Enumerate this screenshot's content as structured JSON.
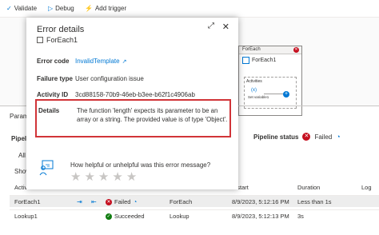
{
  "toolbar": {
    "validate": "Validate",
    "debug": "Debug",
    "add_trigger": "Add trigger"
  },
  "canvas": {
    "card_header": "ForEach",
    "card_title": "ForEach1",
    "activities_label": "Activities",
    "inner_activity": "Set variable1",
    "inner_symbol": "(x)"
  },
  "bottom": {
    "param_tab": "Param",
    "pipeline_run_label": "Pipeli",
    "all_label": "All",
    "show_label": "Show",
    "pipeline_status_label": "Pipeline status",
    "pipeline_status_value": "Failed",
    "columns": {
      "activity": "Activi",
      "run_start": "n start",
      "duration": "Duration",
      "log": "Log"
    },
    "rows": [
      {
        "name": "ForEach1",
        "status": "Failed",
        "type": "ForEach",
        "run_start": "8/9/2023, 5:12:16 PM",
        "duration": "Less than 1s",
        "status_color": "#c50f1f"
      },
      {
        "name": "Lookup1",
        "status": "Succeeded",
        "type": "Lookup",
        "run_start": "8/9/2023, 5:12:13 PM",
        "duration": "3s",
        "status_color": "#107c10"
      }
    ]
  },
  "modal": {
    "title": "Error details",
    "subtitle": "ForEach1",
    "error_code_label": "Error code",
    "error_code_value": "InvalidTemplate",
    "failure_type_label": "Failure type",
    "failure_type_value": "User configuration issue",
    "activity_id_label": "Activity ID",
    "activity_id_value": "3cd88158-70b9-46eb-b3ee-b62f1c4906ab",
    "details_label": "Details",
    "details_value": "The function 'length' expects its parameter to be an array or a string. The provided value is of type 'Object'.",
    "feedback_question": "How helpful or unhelpful was this error message?",
    "star_count": 5
  },
  "colors": {
    "accent": "#0078d4",
    "error": "#c50f1f",
    "success": "#107c10",
    "highlight_border": "#d13438"
  }
}
